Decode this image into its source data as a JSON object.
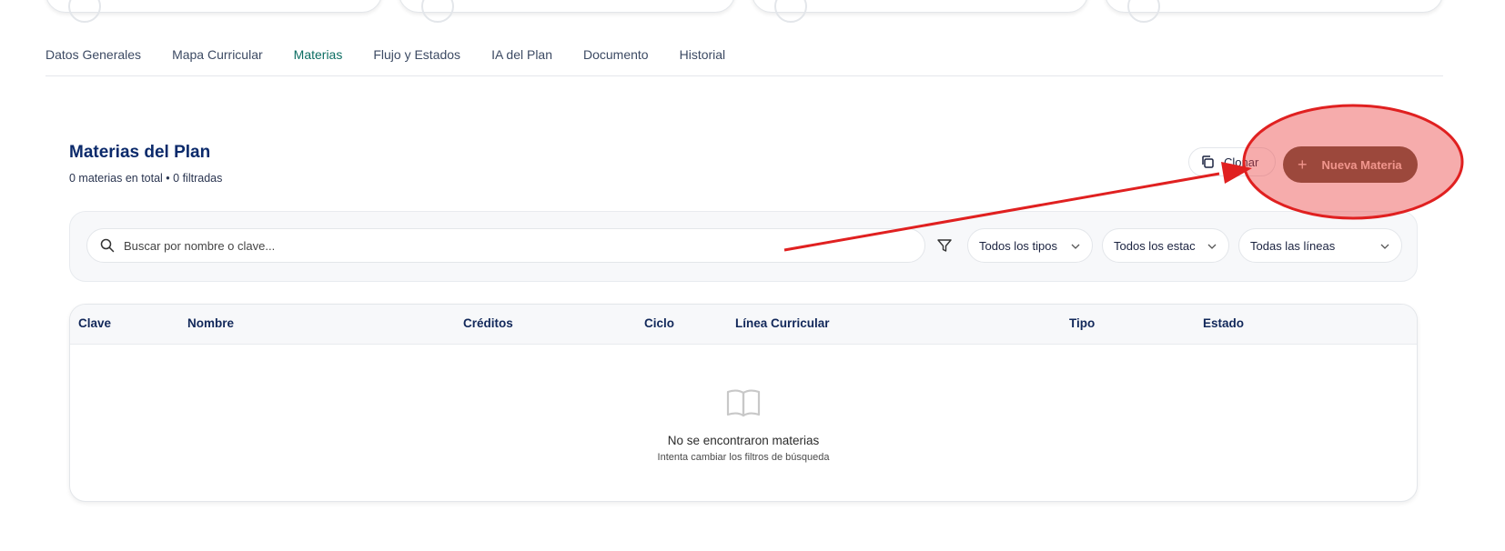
{
  "tabs": [
    {
      "label": "Datos Generales",
      "active": false
    },
    {
      "label": "Mapa Curricular",
      "active": false
    },
    {
      "label": "Materias",
      "active": true
    },
    {
      "label": "Flujo y Estados",
      "active": false
    },
    {
      "label": "IA del Plan",
      "active": false
    },
    {
      "label": "Documento",
      "active": false
    },
    {
      "label": "Historial",
      "active": false
    }
  ],
  "section": {
    "title": "Materias del Plan",
    "summary": "0 materias en total • 0 filtradas"
  },
  "actions": {
    "clone_label": "Clonar",
    "new_label": "Nueva Materia",
    "new_icon": "plus-icon"
  },
  "filters": {
    "search_placeholder": "Buscar por nombre o clave...",
    "type_select": "Todos los tipos",
    "state_select": "Todos los estac",
    "line_select": "Todas las líneas"
  },
  "table": {
    "columns": [
      "Clave",
      "Nombre",
      "Créditos",
      "Ciclo",
      "Línea Curricular",
      "Tipo",
      "Estado"
    ],
    "rows": [],
    "empty_title": "No se encontraron materias",
    "empty_subtitle": "Intenta cambiar los filtros de búsqueda",
    "empty_icon": "book-open-icon"
  },
  "colors": {
    "accent_tab": "#0d6e63",
    "primary_button": "#5b4a34",
    "heading": "#0b2a6b",
    "annotation_red": "#e02020"
  }
}
